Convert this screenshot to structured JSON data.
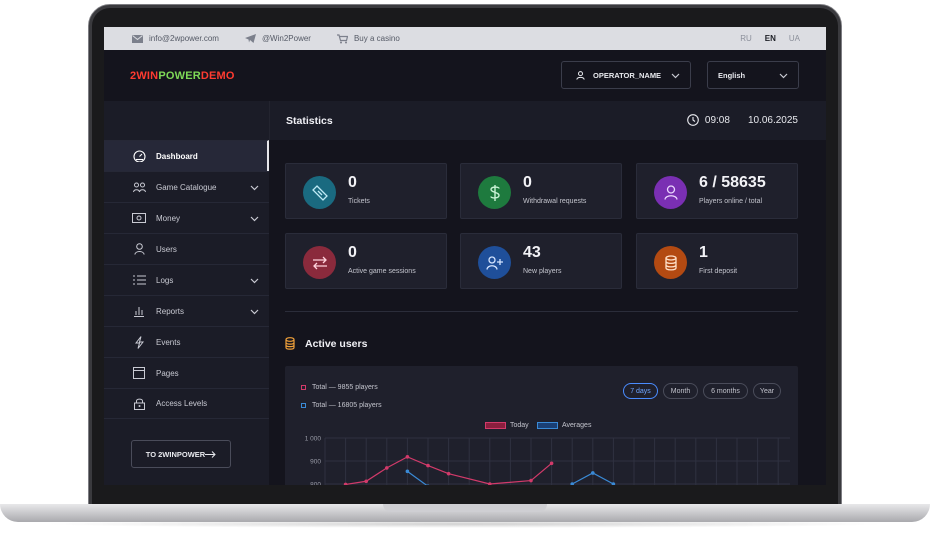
{
  "topbar": {
    "email": "info@2wpower.com",
    "telegram": "@Win2Power",
    "buy": "Buy a casino",
    "languages": [
      "RU",
      "EN",
      "UA"
    ],
    "active_language": "EN"
  },
  "header": {
    "logo_part1": "2WIN",
    "logo_part2": "POWER",
    "logo_part3": "DEMO",
    "operator": "OPERATOR_NAME",
    "language": "English"
  },
  "sidebar": {
    "items": [
      {
        "label": "Dashboard",
        "icon": "dashboard-icon",
        "active": true
      },
      {
        "label": "Game Catalogue",
        "icon": "game-catalogue-icon",
        "has_submenu": true
      },
      {
        "label": "Money",
        "icon": "money-icon",
        "has_submenu": true
      },
      {
        "label": "Users",
        "icon": "user-icon"
      },
      {
        "label": "Logs",
        "icon": "list-icon",
        "has_submenu": true
      },
      {
        "label": "Reports",
        "icon": "bar-chart-icon",
        "has_submenu": true
      },
      {
        "label": "Events",
        "icon": "lightning-icon"
      },
      {
        "label": "Pages",
        "icon": "pages-icon"
      },
      {
        "label": "Access Levels",
        "icon": "lock-icon"
      }
    ],
    "button": "TO 2WINPOWER"
  },
  "main": {
    "title": "Statistics",
    "time": "09:08",
    "date": "10.06.2025",
    "cards": [
      {
        "value": "0",
        "label": "Tickets",
        "icon": "ticket-icon",
        "color": "#1a6a80"
      },
      {
        "value": "0",
        "label": "Withdrawal requests",
        "icon": "dollar-icon",
        "color": "#1e7a3e"
      },
      {
        "value": "6 / 58635",
        "label": "Players online / total",
        "icon": "user-icon",
        "color": "#7a2fb3"
      },
      {
        "value": "0",
        "label": "Active game sessions",
        "icon": "swap-icon",
        "color": "#8a2a3c"
      },
      {
        "value": "43",
        "label": "New players",
        "icon": "add-user-icon",
        "color": "#1f4f9a"
      },
      {
        "value": "1",
        "label": "First deposit",
        "icon": "database-icon",
        "color": "#b34a12"
      }
    ],
    "active_users": {
      "title": "Active users",
      "total_today": "Total — 9855 players",
      "total_avg": "Total — 16805 players",
      "periods": [
        "7 days",
        "Month",
        "6 months",
        "Year"
      ],
      "active_period": "7 days",
      "legend_today": "Today",
      "legend_avg": "Averages"
    }
  },
  "chart_data": {
    "type": "line",
    "ylabels": [
      "1 000",
      "900",
      "800"
    ],
    "ylim": [
      780,
      1000
    ],
    "series": [
      {
        "name": "Today",
        "color": "#d23a6a",
        "points": [
          [
            1,
            798
          ],
          [
            2,
            812
          ],
          [
            3,
            870
          ],
          [
            4,
            918
          ],
          [
            5,
            880
          ],
          [
            6,
            845
          ],
          [
            8,
            800
          ],
          [
            10,
            815
          ],
          [
            11,
            890
          ]
        ]
      },
      {
        "name": "Averages",
        "color": "#3a8ad6",
        "points": [
          [
            4,
            855
          ],
          [
            5,
            790
          ],
          [
            12,
            800
          ],
          [
            13,
            848
          ],
          [
            14,
            800
          ]
        ]
      }
    ],
    "colors": {
      "today": "#d23a6a",
      "averages": "#3a8ad6"
    }
  }
}
